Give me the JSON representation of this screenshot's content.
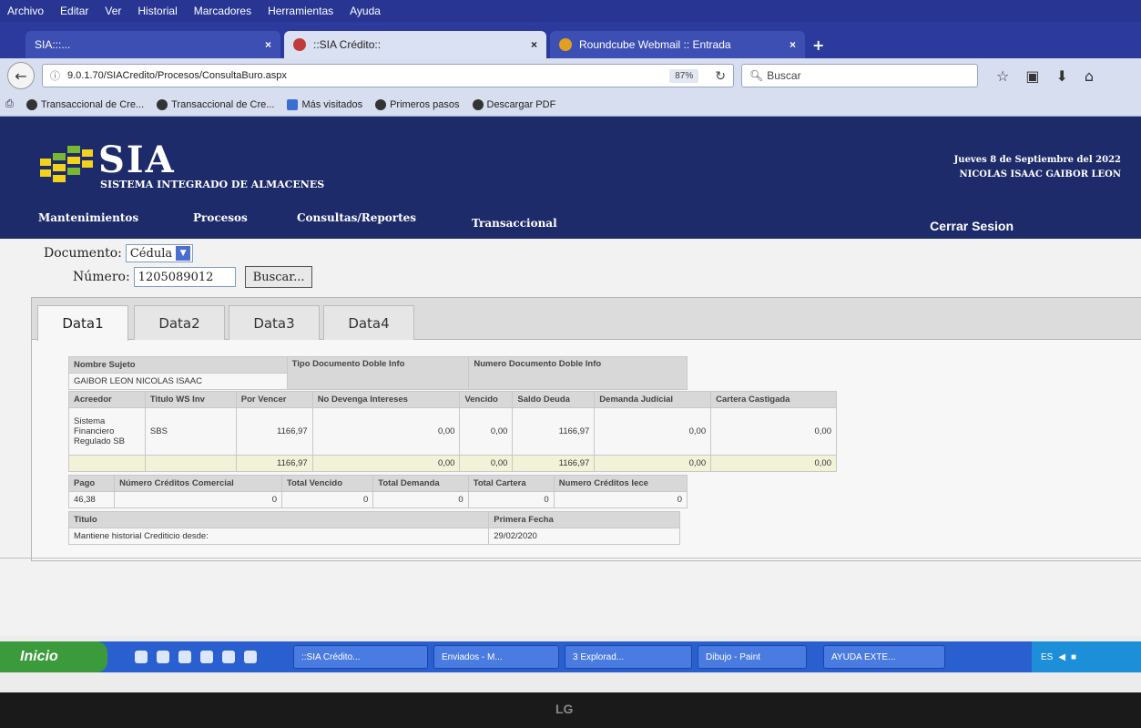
{
  "menu": [
    "Archivo",
    "Editar",
    "Ver",
    "Historial",
    "Marcadores",
    "Herramientas",
    "Ayuda"
  ],
  "browser_tabs": [
    {
      "title": "SIA:::..."
    },
    {
      "title": "::SIA Crédito::"
    },
    {
      "title": "Roundcube Webmail :: Entrada"
    }
  ],
  "tab_close": "×",
  "new_tab": "+",
  "nav": {
    "url": "9.0.1.70/SIACredito/Procesos/ConsultaBuro.aspx",
    "zoom": "87%",
    "search_placeholder": "Buscar"
  },
  "bookmarks": [
    "Transaccional de Cre...",
    "Transaccional de Cre...",
    "Más visitados",
    "Primeros pasos",
    "Descargar PDF"
  ],
  "header": {
    "title": "SIA",
    "subtitle": "SISTEMA INTEGRADO DE ALMACENES",
    "date": "Jueves 8 de Septiembre del 2022",
    "user": "NICOLAS ISAAC GAIBOR LEON"
  },
  "app_nav": [
    "Mantenimientos",
    "Procesos",
    "Consultas/Reportes",
    "Transaccional"
  ],
  "logout": "Cerrar Sesion",
  "form": {
    "doc_label": "Documento:",
    "doc_value": "Cédula",
    "num_label": "Número:",
    "num_value": "1205089012",
    "search_btn": "Buscar..."
  },
  "data_tabs": [
    "Data1",
    "Data2",
    "Data3",
    "Data4"
  ],
  "table1": {
    "headers": [
      "Nombre Sujeto",
      "Tipo Documento Doble Info",
      "Numero Documento Doble Info"
    ],
    "subject": "GAIBOR LEON NICOLAS ISAAC"
  },
  "table2": {
    "headers": [
      "Acreedor",
      "Titulo WS Inv",
      "Por Vencer",
      "No Devenga Intereses",
      "Vencido",
      "Saldo Deuda",
      "Demanda Judicial",
      "Cartera Castigada"
    ],
    "row": [
      "Sistema Financiero Regulado SB",
      "SBS",
      "1166,97",
      "0,00",
      "0,00",
      "1166,97",
      "0,00",
      "0,00"
    ],
    "totals": [
      "1166,97",
      "0,00",
      "0,00",
      "1166,97",
      "0,00",
      "0,00"
    ]
  },
  "table3": {
    "headers": [
      "Pago",
      "Número Créditos Comercial",
      "Total Vencido",
      "Total Demanda",
      "Total Cartera",
      "Numero Créditos Iece"
    ],
    "row": [
      "46,38",
      "0",
      "0",
      "0",
      "0",
      "0"
    ]
  },
  "table4": {
    "headers": [
      "Titulo",
      "Primera Fecha"
    ],
    "row": [
      "Mantiene historial Crediticio desde:",
      "29/02/2020"
    ]
  },
  "taskbar": {
    "start": "Inicio",
    "tasks": [
      "::SIA Crédito...",
      "Enviados - M...",
      "3 Explorad...",
      "Dibujo - Paint",
      "AYUDA EXTE..."
    ],
    "lang": "ES"
  },
  "monitor_brand": "LG",
  "colors": {
    "header_bg": "#1e2b6b",
    "taskbar_bg": "#2a5fd0",
    "start_green": "#3b9a3b",
    "logo_yellow": "#f2d21b",
    "logo_green": "#78b833"
  }
}
